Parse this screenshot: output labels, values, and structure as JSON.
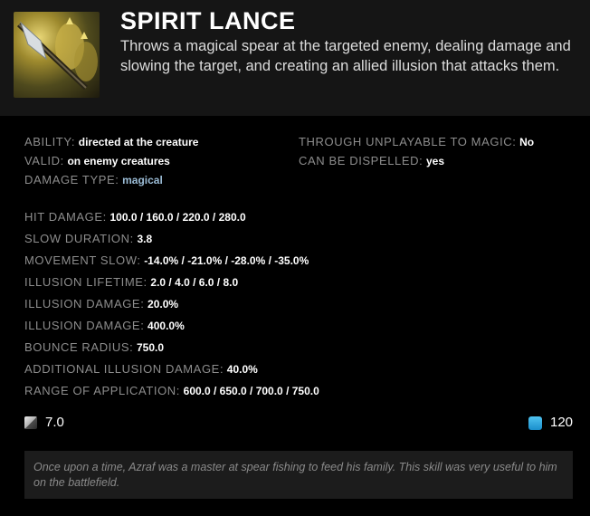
{
  "ability": {
    "name": "SPIRIT LANCE",
    "description": "Throws a magical spear at the targeted enemy, dealing damage and slowing the target, and creating an allied illusion that attacks them."
  },
  "attributes_left": [
    {
      "label": "ABILITY:",
      "value": "directed at the creature"
    },
    {
      "label": "VALID:",
      "value": "on enemy creatures"
    },
    {
      "label": "DAMAGE TYPE:",
      "value": "magical"
    }
  ],
  "attributes_right": [
    {
      "label": "THROUGH UNPLAYABLE TO MAGIC:",
      "value": "No"
    },
    {
      "label": "CAN BE DISPELLED:",
      "value": "yes"
    }
  ],
  "stats": [
    {
      "label": "HIT DAMAGE:",
      "value": "100.0 / 160.0 / 220.0 / 280.0"
    },
    {
      "label": "SLOW DURATION:",
      "value": "3.8"
    },
    {
      "label": "MOVEMENT SLOW:",
      "value": "-14.0% / -21.0% / -28.0% / -35.0%"
    },
    {
      "label": "ILLUSION LIFETIME:",
      "value": "2.0 / 4.0 / 6.0 / 8.0"
    },
    {
      "label": "ILLUSION DAMAGE:",
      "value": "20.0%"
    },
    {
      "label": "ILLUSION DAMAGE:",
      "value": "400.0%"
    },
    {
      "label": "BOUNCE RADIUS:",
      "value": "750.0"
    },
    {
      "label": "ADDITIONAL ILLUSION DAMAGE:",
      "value": "40.0%"
    },
    {
      "label": "RANGE OF APPLICATION:",
      "value": "600.0 / 650.0 / 700.0 / 750.0"
    }
  ],
  "cooldown": {
    "icon": "cooldown-icon",
    "value": "7.0"
  },
  "mana_cost": {
    "icon": "mana-icon",
    "value": "120",
    "color": "#2aa7e0"
  },
  "lore": "Once upon a time, Azraf was a master at spear fishing to feed his family. This skill was very useful to him on the battlefield.",
  "colors": {
    "magic": "#9bbcd6",
    "header_bg": "#151515",
    "lore_bg": "#1c1c1c"
  }
}
